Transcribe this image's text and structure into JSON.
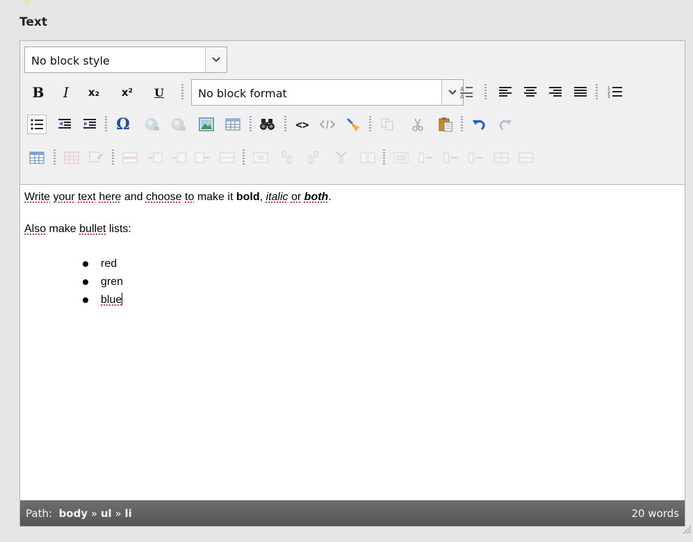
{
  "field": {
    "label": "Text"
  },
  "toolbar": {
    "block_style": "No block style",
    "block_format": "No block format",
    "bold_label": "B",
    "italic_label": "I",
    "subscript_label": "x₂",
    "superscript_label": "x²",
    "underline_label": "U",
    "special_char_label": "Ω",
    "source_label": "<>"
  },
  "content": {
    "p1": {
      "w1": "Write",
      "w2": "your",
      "w3": "text",
      "w4": "here",
      "w5": "and",
      "w6": "choose",
      "w7": "to",
      "w8": "make it",
      "bold": "bold",
      "comma": ",",
      "italic": "italic",
      "or": "or",
      "both": "both",
      "end": "."
    },
    "p2": {
      "w1": "Also",
      "w2": "make",
      "w3": "bullet",
      "w4": "lists:"
    },
    "list": [
      "red",
      "gren",
      "blue"
    ]
  },
  "statusbar": {
    "path_label": "Path:",
    "path": [
      "body",
      "ul",
      "li"
    ],
    "path_sep": "»",
    "word_count": "20 words"
  },
  "colors": {
    "toolbar_bg": "#f0f0f0",
    "statusbar_bg": "#5d5d5d",
    "spell_underline": "#d00000"
  }
}
